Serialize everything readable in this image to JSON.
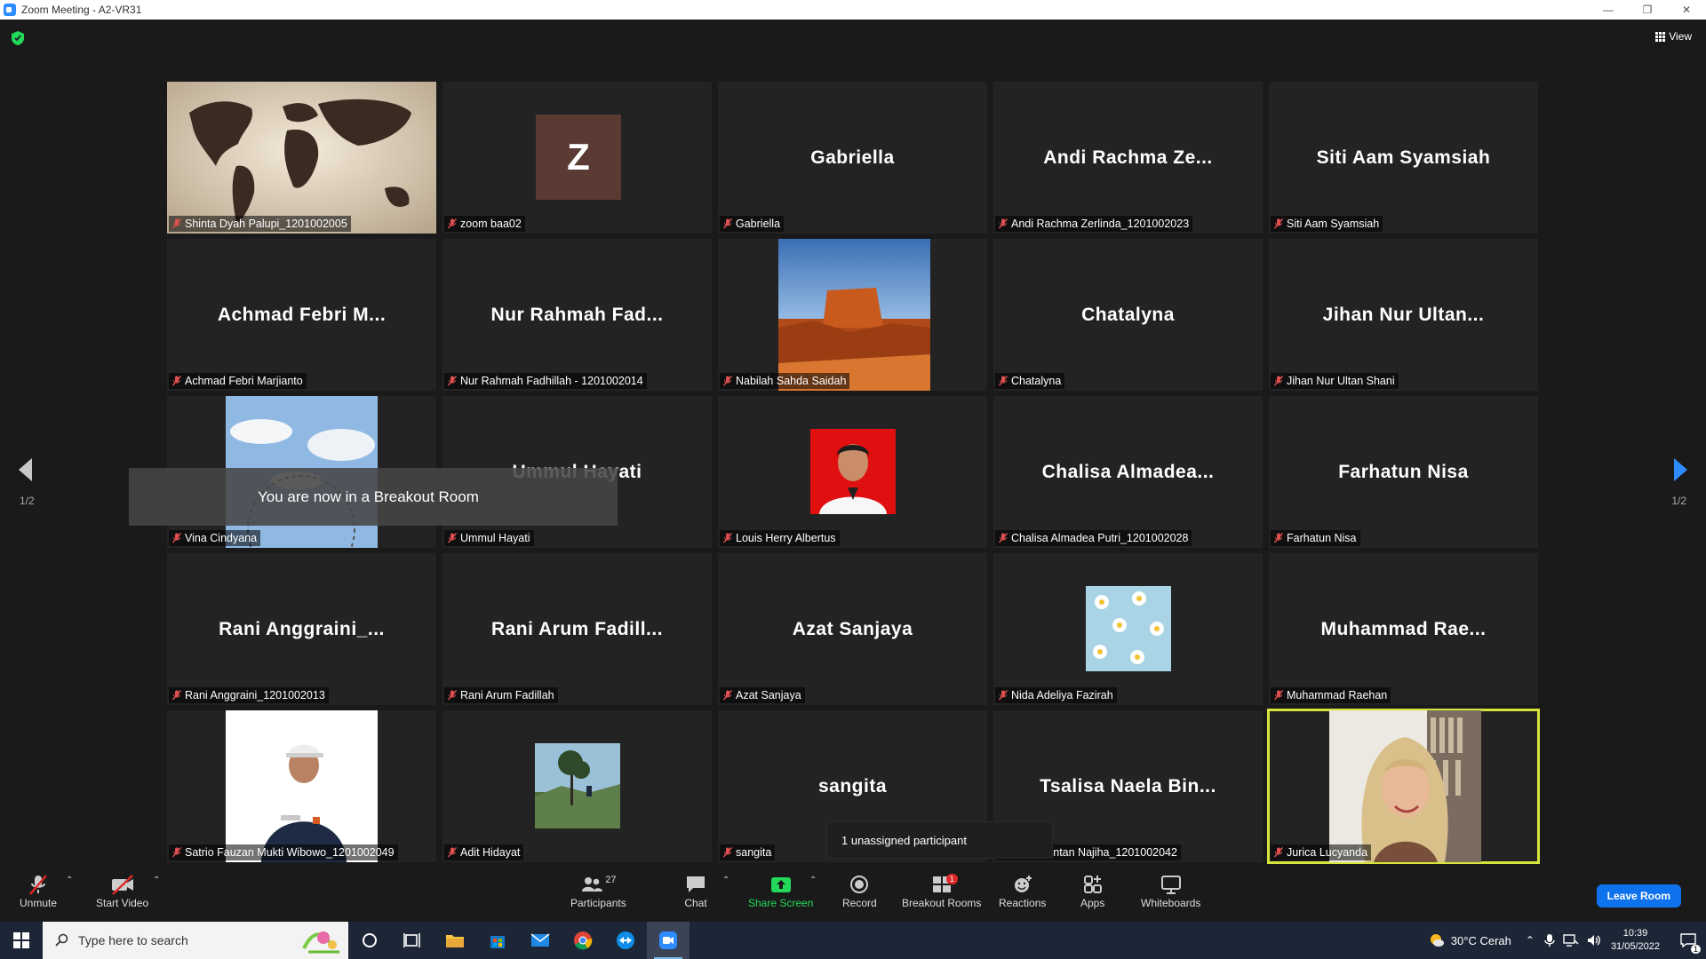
{
  "window": {
    "title": "Zoom Meeting - A2-VR31"
  },
  "header": {
    "view_label": "View"
  },
  "tiles": [
    {
      "big": "",
      "label": "Shinta Dyah Palupi_1201002005",
      "kind": "map"
    },
    {
      "big": "Z",
      "label": "zoom baa02",
      "kind": "avatar"
    },
    {
      "big": "Gabriella",
      "label": "Gabriella",
      "kind": "name"
    },
    {
      "big": "Andi Rachma Ze...",
      "label": "Andi Rachma Zerlinda_1201002023",
      "kind": "name"
    },
    {
      "big": "Siti Aam Syamsiah",
      "label": "Siti Aam Syamsiah",
      "kind": "name"
    },
    {
      "big": "Achmad Febri M...",
      "label": "Achmad Febri Marjianto",
      "kind": "name"
    },
    {
      "big": "Nur Rahmah Fad...",
      "label": "Nur Rahmah Fadhillah - 1201002014",
      "kind": "name"
    },
    {
      "big": "",
      "label": "Nabilah Sahda Saidah",
      "kind": "desert"
    },
    {
      "big": "Chatalyna",
      "label": "Chatalyna",
      "kind": "name"
    },
    {
      "big": "Jihan Nur Ultan...",
      "label": "Jihan Nur Ultan Shani",
      "kind": "name"
    },
    {
      "big": "",
      "label": "Vina Cindyana",
      "kind": "sky"
    },
    {
      "big": "Ummul Hayati",
      "label": "Ummul Hayati",
      "kind": "name"
    },
    {
      "big": "",
      "label": "Louis Herry Albertus",
      "kind": "portrait-red"
    },
    {
      "big": "Chalisa Almadea...",
      "label": "Chalisa Almadea Putri_1201002028",
      "kind": "name"
    },
    {
      "big": "Farhatun Nisa",
      "label": "Farhatun Nisa",
      "kind": "name"
    },
    {
      "big": "Rani Anggraini_...",
      "label": "Rani Anggraini_1201002013",
      "kind": "name"
    },
    {
      "big": "Rani Arum Fadill...",
      "label": "Rani Arum Fadillah",
      "kind": "name"
    },
    {
      "big": "Azat Sanjaya",
      "label": "Azat Sanjaya",
      "kind": "name"
    },
    {
      "big": "",
      "label": "Nida Adeliya Fazirah",
      "kind": "daisy"
    },
    {
      "big": "Muhammad Rae...",
      "label": "Muhammad Raehan",
      "kind": "name"
    },
    {
      "big": "",
      "label": "Satrio Fauzan Mukti Wibowo_1201002049",
      "kind": "man"
    },
    {
      "big": "",
      "label": "Adit Hidayat",
      "kind": "tree"
    },
    {
      "big": "sangita",
      "label": "sangita",
      "kind": "name"
    },
    {
      "big": "Tsalisa Naela Bin...",
      "label": "Naela Bintan Najiha_1201002042",
      "kind": "name"
    },
    {
      "big": "",
      "label": "Jurica Lucyanda",
      "kind": "woman"
    }
  ],
  "paging": {
    "left": "1/2",
    "right": "1/2"
  },
  "toast": "You are now in a Breakout Room",
  "tooltip": "1 unassigned participant",
  "toolbar": {
    "unmute": "Unmute",
    "start_video": "Start Video",
    "participants": "Participants",
    "participants_count": "27",
    "chat": "Chat",
    "share_screen": "Share Screen",
    "record": "Record",
    "breakout_rooms": "Breakout Rooms",
    "breakout_badge": "1",
    "reactions": "Reactions",
    "apps": "Apps",
    "whiteboards": "Whiteboards",
    "leave": "Leave Room"
  },
  "taskbar": {
    "search_placeholder": "Type here to search",
    "weather": "30°C  Cerah",
    "time": "10:39",
    "date": "31/05/2022",
    "notif_count": "1"
  },
  "colors": {
    "accent": "#0e72ed",
    "active_speaker": "#d7e53a",
    "share_green": "#23d959",
    "muted_red": "#e02828"
  }
}
